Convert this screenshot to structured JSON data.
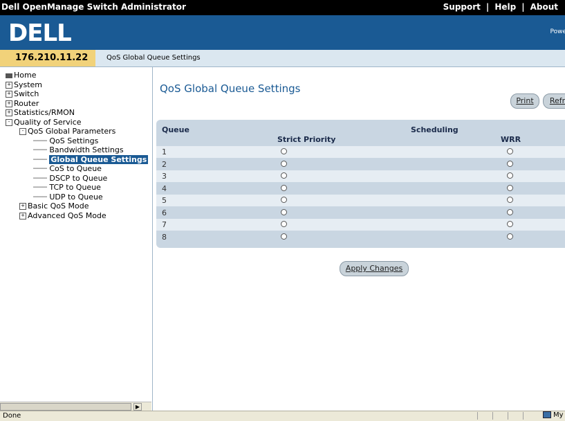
{
  "window": {
    "app_title": "Dell OpenManage Switch Administrator",
    "links": [
      "Support",
      "Help",
      "About"
    ],
    "brand": "DELL",
    "powered": "Powe"
  },
  "ipbar": {
    "ip": "176.210.11.22",
    "breadcrumb": "QoS Global Queue Settings"
  },
  "sidebar": {
    "tree": [
      {
        "label": "Home",
        "level": 0,
        "expander": ""
      },
      {
        "label": "System",
        "level": 0,
        "expander": "+"
      },
      {
        "label": "Switch",
        "level": 0,
        "expander": "+"
      },
      {
        "label": "Router",
        "level": 0,
        "expander": "+"
      },
      {
        "label": "Statistics/RMON",
        "level": 0,
        "expander": "+"
      },
      {
        "label": "Quality of Service",
        "level": 0,
        "expander": "-"
      },
      {
        "label": "QoS Global Parameters",
        "level": 1,
        "expander": "-"
      },
      {
        "label": "QoS Settings",
        "level": 2,
        "expander": ""
      },
      {
        "label": "Bandwidth Settings",
        "level": 2,
        "expander": ""
      },
      {
        "label": "Global Queue Settings",
        "level": 2,
        "expander": "",
        "selected": true
      },
      {
        "label": "CoS to Queue",
        "level": 2,
        "expander": ""
      },
      {
        "label": "DSCP to Queue",
        "level": 2,
        "expander": ""
      },
      {
        "label": "TCP to Queue",
        "level": 2,
        "expander": ""
      },
      {
        "label": "UDP to Queue",
        "level": 2,
        "expander": ""
      },
      {
        "label": "Basic QoS Mode",
        "level": 1,
        "expander": "+"
      },
      {
        "label": "Advanced QoS Mode",
        "level": 1,
        "expander": "+"
      }
    ]
  },
  "main": {
    "title": "QoS Global Queue Settings",
    "print_label": "Print",
    "refresh_label": "Refr",
    "apply_label": "Apply Changes",
    "table": {
      "queue_header": "Queue",
      "scheduling_header": "Scheduling",
      "strict_header": "Strict Priority",
      "wrr_header": "WRR",
      "rows": [
        "1",
        "2",
        "3",
        "4",
        "5",
        "6",
        "7",
        "8"
      ]
    }
  },
  "status": {
    "text": "Done",
    "zone": "My Comp"
  }
}
